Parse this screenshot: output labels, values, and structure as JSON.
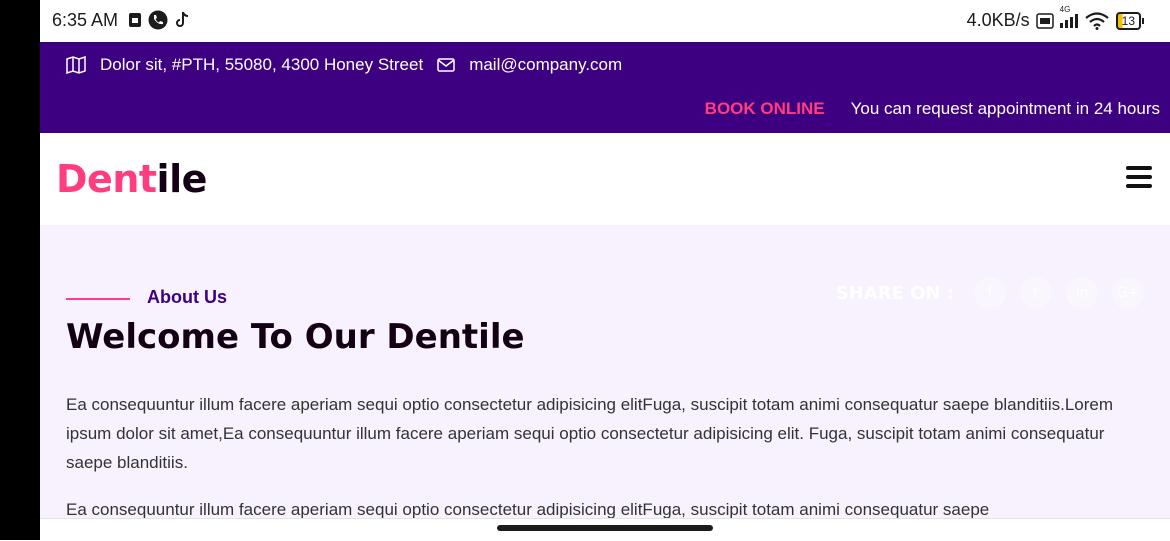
{
  "status_bar": {
    "time": "6:35 AM",
    "net_speed": "4.0KB/s",
    "network_type": "4G",
    "battery": "13"
  },
  "topbar": {
    "address": "Dolor sit, #PTH, 55080, 4300 Honey Street",
    "email": "mail@company.com",
    "book_label": "BOOK ONLINE",
    "appointment_text": "You can request appointment in 24 hours"
  },
  "header": {
    "logo_part1": "Dent",
    "logo_part2": "ile"
  },
  "main": {
    "section_label": "About Us",
    "title": "Welcome To Our Dentile",
    "share_label": "SHARE ON :",
    "share_icons": [
      "f",
      "t",
      "in",
      "G+"
    ],
    "paragraph1": "Ea consequuntur illum facere aperiam sequi optio consectetur adipisicing elitFuga, suscipit totam animi consequatur saepe blanditiis.Lorem ipsum dolor sit amet,Ea consequuntur illum facere aperiam sequi optio consectetur adipisicing elit. Fuga, suscipit totam animi consequatur saepe blanditiis.",
    "paragraph2": "Ea consequuntur illum facere aperiam sequi optio consectetur adipisicing elitFuga, suscipit totam animi consequatur saepe"
  },
  "colors": {
    "topbar_bg": "#3d0080",
    "accent_pink": "#ff3d7f",
    "section_bg": "#f7f2fd"
  }
}
